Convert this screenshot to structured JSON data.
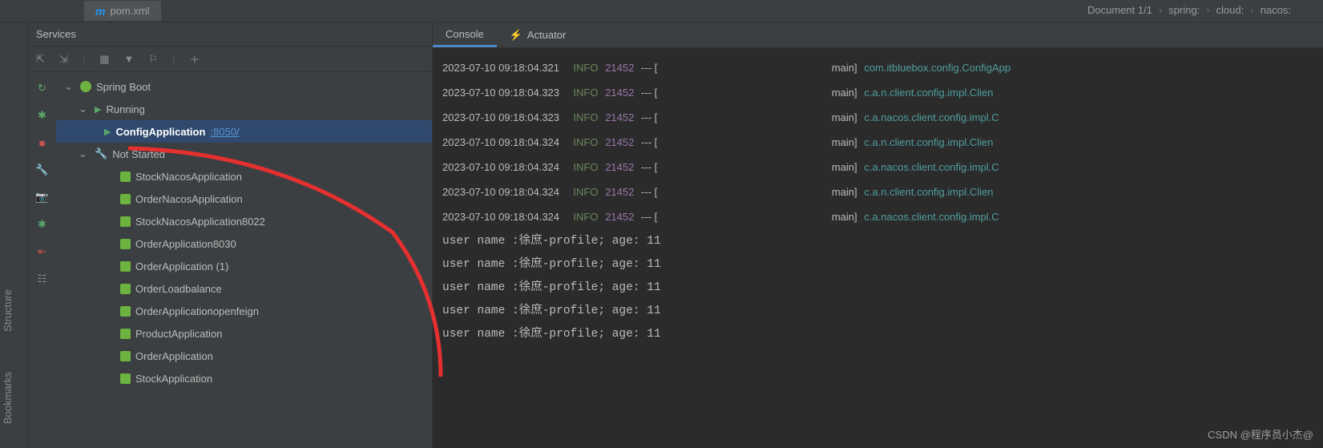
{
  "fileTab": {
    "icon": "m",
    "name": "pom.xml"
  },
  "breadcrumb": [
    "Document 1/1",
    "spring:",
    "cloud:",
    "nacos:"
  ],
  "panelTitle": "Services",
  "tree": {
    "root": "Spring Boot",
    "running": {
      "label": "Running",
      "app": {
        "name": "ConfigApplication",
        "port": ":8050/"
      }
    },
    "notStarted": {
      "label": "Not Started",
      "apps": [
        "StockNacosApplication",
        "OrderNacosApplication",
        "StockNacosApplication8022",
        "OrderApplication8030",
        "OrderApplication (1)",
        "OrderLoadbalance",
        "OrderApplicationopenfeign",
        "ProductApplication",
        "OrderApplication",
        "StockApplication"
      ]
    }
  },
  "consoleTabs": {
    "console": "Console",
    "actuator": "Actuator"
  },
  "logLines": [
    {
      "ts": "2023-07-10 09:18:04.321",
      "level": "INFO",
      "pid": "21452",
      "thread": "main",
      "cls": "com.itbluebox.config.ConfigApp"
    },
    {
      "ts": "2023-07-10 09:18:04.323",
      "level": "INFO",
      "pid": "21452",
      "thread": "main",
      "cls": "c.a.n.client.config.impl.Clien"
    },
    {
      "ts": "2023-07-10 09:18:04.323",
      "level": "INFO",
      "pid": "21452",
      "thread": "main",
      "cls": "c.a.nacos.client.config.impl.C"
    },
    {
      "ts": "2023-07-10 09:18:04.324",
      "level": "INFO",
      "pid": "21452",
      "thread": "main",
      "cls": "c.a.n.client.config.impl.Clien"
    },
    {
      "ts": "2023-07-10 09:18:04.324",
      "level": "INFO",
      "pid": "21452",
      "thread": "main",
      "cls": "c.a.nacos.client.config.impl.C"
    },
    {
      "ts": "2023-07-10 09:18:04.324",
      "level": "INFO",
      "pid": "21452",
      "thread": "main",
      "cls": "c.a.n.client.config.impl.Clien"
    },
    {
      "ts": "2023-07-10 09:18:04.324",
      "level": "INFO",
      "pid": "21452",
      "thread": "main",
      "cls": "c.a.nacos.client.config.impl.C"
    }
  ],
  "userLines": [
    "user name :徐庶-profile; age: 11",
    "user name :徐庶-profile; age: 11",
    "user name :徐庶-profile; age: 11",
    "user name :徐庶-profile; age: 11",
    "user name :徐庶-profile; age: 11"
  ],
  "sideLabels": {
    "structure": "Structure",
    "bookmarks": "Bookmarks"
  },
  "watermark": "CSDN @程序员小杰@"
}
